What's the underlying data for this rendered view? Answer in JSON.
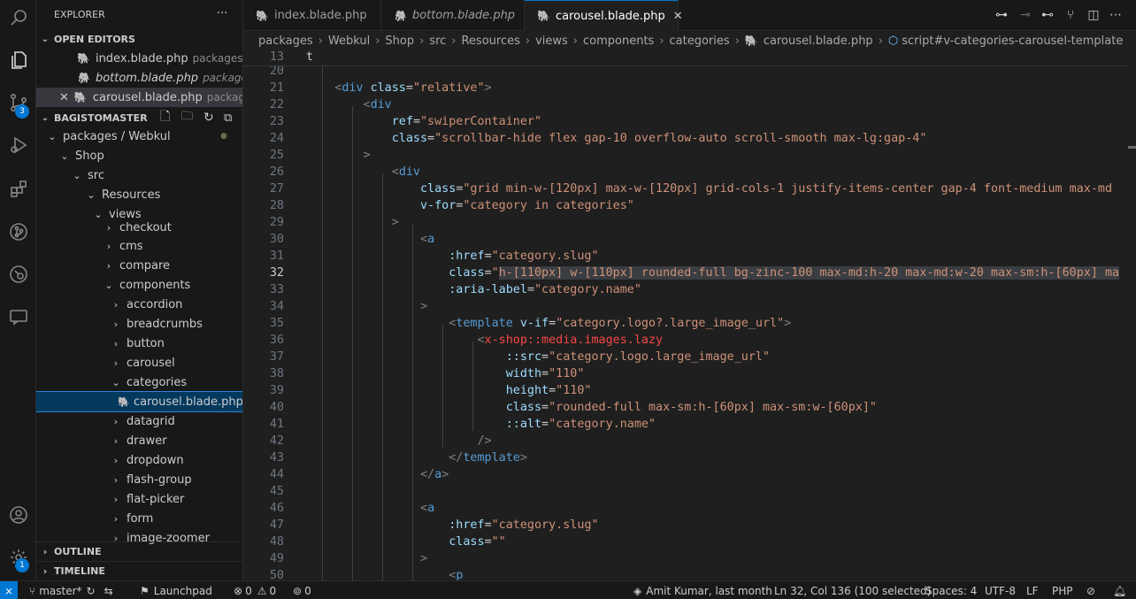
{
  "explorer": {
    "title": "EXPLORER",
    "more": "···"
  },
  "open_editors": {
    "title": "OPEN EDITORS",
    "items": [
      {
        "name": "index.blade.php",
        "path": "packages/..."
      },
      {
        "name": "bottom.blade.php",
        "path": "packages..."
      },
      {
        "name": "carousel.blade.php",
        "path": "packag..."
      }
    ]
  },
  "workspace": {
    "title": "BAGISTOMASTER"
  },
  "tree": [
    {
      "label": "packages / Webkul",
      "chev": "⌄"
    },
    {
      "label": "Shop",
      "chev": "⌄"
    },
    {
      "label": "src",
      "chev": "⌄"
    },
    {
      "label": "Resources",
      "chev": "⌄"
    },
    {
      "label": "views",
      "chev": "⌄"
    },
    {
      "label": "checkout",
      "chev": "›"
    },
    {
      "label": "cms",
      "chev": "›"
    },
    {
      "label": "compare",
      "chev": "›"
    },
    {
      "label": "components",
      "chev": "⌄"
    },
    {
      "label": "accordion",
      "chev": "›"
    },
    {
      "label": "breadcrumbs",
      "chev": "›"
    },
    {
      "label": "button",
      "chev": "›"
    },
    {
      "label": "carousel",
      "chev": "›"
    },
    {
      "label": "categories",
      "chev": "⌄"
    },
    {
      "label": "carousel.blade.php",
      "chev": ""
    },
    {
      "label": "datagrid",
      "chev": "›"
    },
    {
      "label": "drawer",
      "chev": "›"
    },
    {
      "label": "dropdown",
      "chev": "›"
    },
    {
      "label": "flash-group",
      "chev": "›"
    },
    {
      "label": "flat-picker",
      "chev": "›"
    },
    {
      "label": "form",
      "chev": "›"
    },
    {
      "label": "image-zoomer",
      "chev": "›"
    }
  ],
  "outline": "OUTLINE",
  "timeline": "TIMELINE",
  "tabs": [
    {
      "label": "index.blade.php"
    },
    {
      "label": "bottom.blade.php"
    },
    {
      "label": "carousel.blade.php"
    }
  ],
  "breadcrumb": [
    "packages",
    "Webkul",
    "Shop",
    "src",
    "Resources",
    "views",
    "components",
    "categories",
    "carousel.blade.php",
    "script#v-categories-carousel-template"
  ],
  "sticky": {
    "num": "13",
    "text": "t"
  },
  "lines": [
    {
      "n": "20",
      "html": ""
    },
    {
      "n": "21",
      "html": "    <span class='p'>&lt;</span><span class='t'>div</span> <span class='a'>class</span>=<span class='s'>\"relative\"</span><span class='p'>&gt;</span>"
    },
    {
      "n": "22",
      "html": "        <span class='p'>&lt;</span><span class='t'>div</span>"
    },
    {
      "n": "23",
      "html": "            <span class='a'>ref</span>=<span class='s'>\"swiperContainer\"</span>"
    },
    {
      "n": "24",
      "html": "            <span class='a'>class</span>=<span class='s'>\"scrollbar-hide flex gap-10 overflow-auto scroll-smooth max-lg:gap-4\"</span>"
    },
    {
      "n": "25",
      "html": "        <span class='p'>&gt;</span>"
    },
    {
      "n": "26",
      "html": "            <span class='p'>&lt;</span><span class='t'>div</span>"
    },
    {
      "n": "27",
      "html": "                <span class='a'>class</span>=<span class='s'>\"grid min-w-[120px] max-w-[120px] grid-cols-1 justify-items-center gap-4 font-medium max-md</span>"
    },
    {
      "n": "28",
      "html": "                <span class='a'>v-for</span>=<span class='s'>\"category in categories\"</span>"
    },
    {
      "n": "29",
      "html": "            <span class='p'>&gt;</span>"
    },
    {
      "n": "30",
      "html": "                <span class='p'>&lt;</span><span class='t'>a</span>"
    },
    {
      "n": "31",
      "html": "                    <span class='a'>:href</span>=<span class='s'>\"category.slug\"</span>"
    },
    {
      "n": "32",
      "html": "                    <span class='a'>class</span>=<span class='s'>\"<span class='hl'>h-[110px] w-[110px] rounded-full bg-zinc-100 max-md:h-20 max-md:w-20 max-sm:h-[60px] ma</span></span>"
    },
    {
      "n": "33",
      "html": "                    <span class='a'>:aria-label</span>=<span class='s'>\"category.name\"</span>"
    },
    {
      "n": "34",
      "html": "                <span class='p'>&gt;</span>"
    },
    {
      "n": "35",
      "html": "                    <span class='p'>&lt;</span><span class='t'>template</span> <span class='a'>v-if</span>=<span class='s'>\"category.logo?.large_image_url\"</span><span class='p'>&gt;</span>"
    },
    {
      "n": "36",
      "html": "                        <span class='p'>&lt;</span><span class='r'>x-shop::media.images.lazy</span>"
    },
    {
      "n": "37",
      "html": "                            <span class='a'>::src</span>=<span class='s'>\"category.logo.large_image_url\"</span>"
    },
    {
      "n": "38",
      "html": "                            <span class='a'>width</span>=<span class='s'>\"110\"</span>"
    },
    {
      "n": "39",
      "html": "                            <span class='a'>height</span>=<span class='s'>\"110\"</span>"
    },
    {
      "n": "40",
      "html": "                            <span class='a'>class</span>=<span class='s'>\"rounded-full max-sm:h-[60px] max-sm:w-[60px]\"</span>"
    },
    {
      "n": "41",
      "html": "                            <span class='a'>::alt</span>=<span class='s'>\"category.name\"</span>"
    },
    {
      "n": "42",
      "html": "                        <span class='p'>/&gt;</span>"
    },
    {
      "n": "43",
      "html": "                    <span class='p'>&lt;/</span><span class='t'>template</span><span class='p'>&gt;</span>"
    },
    {
      "n": "44",
      "html": "                <span class='p'>&lt;/</span><span class='t'>a</span><span class='p'>&gt;</span>"
    },
    {
      "n": "45",
      "html": ""
    },
    {
      "n": "46",
      "html": "                <span class='p'>&lt;</span><span class='t'>a</span>"
    },
    {
      "n": "47",
      "html": "                    <span class='a'>:href</span>=<span class='s'>\"category.slug\"</span>"
    },
    {
      "n": "48",
      "html": "                    <span class='a'>class</span>=<span class='s'>\"\"</span>"
    },
    {
      "n": "49",
      "html": "                <span class='p'>&gt;</span>"
    },
    {
      "n": "50",
      "html": "                    <span class='p'>&lt;</span><span class='t'>p</span>"
    }
  ],
  "current_line": "32",
  "status": {
    "branch": "master*",
    "launchpad": "Launchpad",
    "errors": "0",
    "warnings": "0",
    "ports": "0",
    "blame": "Amit Kumar, last month",
    "position": "Ln 32, Col 136 (100 selected)",
    "spaces": "Spaces: 4",
    "encoding": "UTF-8",
    "eol": "LF",
    "language": "PHP"
  },
  "badges": {
    "scm": "3",
    "settings": "1"
  },
  "colors": {
    "accent": "#0078d4",
    "php_icon": "#a074c4"
  }
}
